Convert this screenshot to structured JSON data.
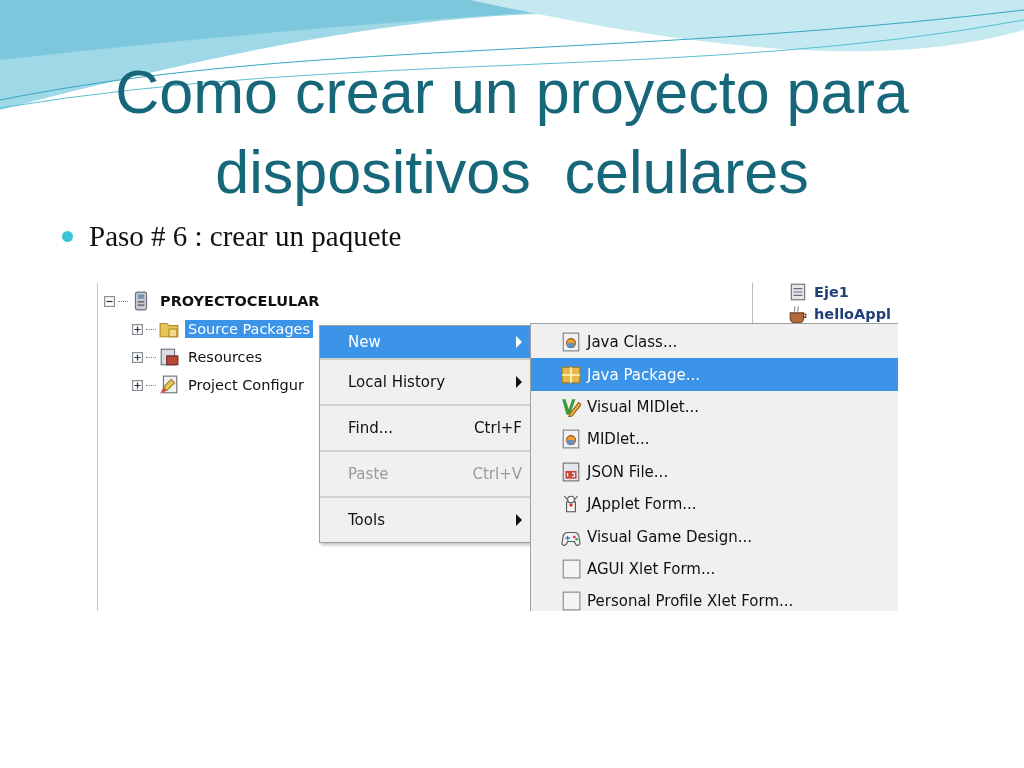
{
  "slide": {
    "title_lines": [
      "Como crear un proyecto para",
      "dispositivos  celulares"
    ],
    "bullets": [
      "Paso # 6 : crear un paquete"
    ]
  },
  "screenshot": {
    "tree": {
      "label": "PROYECTOCELULAR",
      "kind": "project",
      "expanded": true,
      "children": [
        {
          "label": "Source Packages",
          "kind": "sources",
          "expanded": false,
          "selected": true
        },
        {
          "label": "Resources",
          "kind": "resources",
          "expanded": false,
          "selected": false
        },
        {
          "label": "Project Configur",
          "kind": "config",
          "expanded": false,
          "selected": false
        }
      ]
    },
    "side_items": [
      {
        "label": "Eje1",
        "kind": "file"
      },
      {
        "label": "helloAppl",
        "kind": "cup"
      }
    ],
    "context_menu": [
      {
        "label": "New",
        "submenu": true,
        "selected": true,
        "disabled": false
      },
      {
        "label": "Local History",
        "submenu": true,
        "selected": false,
        "disabled": false
      },
      {
        "label": "Find...",
        "shortcut": "Ctrl+F",
        "submenu": false,
        "selected": false,
        "disabled": false
      },
      {
        "label": "Paste",
        "shortcut": "Ctrl+V",
        "submenu": false,
        "selected": false,
        "disabled": true
      },
      {
        "label": "Tools",
        "submenu": true,
        "selected": false,
        "disabled": false
      }
    ],
    "submenu": [
      {
        "label": "Java Class...",
        "kind": "class",
        "selected": false
      },
      {
        "label": "Java Package...",
        "kind": "package",
        "selected": true
      },
      {
        "label": "Visual MIDlet...",
        "kind": "visual",
        "selected": false
      },
      {
        "label": "MIDlet...",
        "kind": "class",
        "selected": false
      },
      {
        "label": "JSON File...",
        "kind": "json",
        "selected": false
      },
      {
        "label": "JApplet Form...",
        "kind": "applet",
        "selected": false
      },
      {
        "label": "Visual Game Design...",
        "kind": "game",
        "selected": false
      },
      {
        "label": "AGUI Xlet Form...",
        "kind": "form",
        "selected": false
      },
      {
        "label": "Personal Profile Xlet Form...",
        "kind": "form",
        "selected": false
      }
    ]
  }
}
